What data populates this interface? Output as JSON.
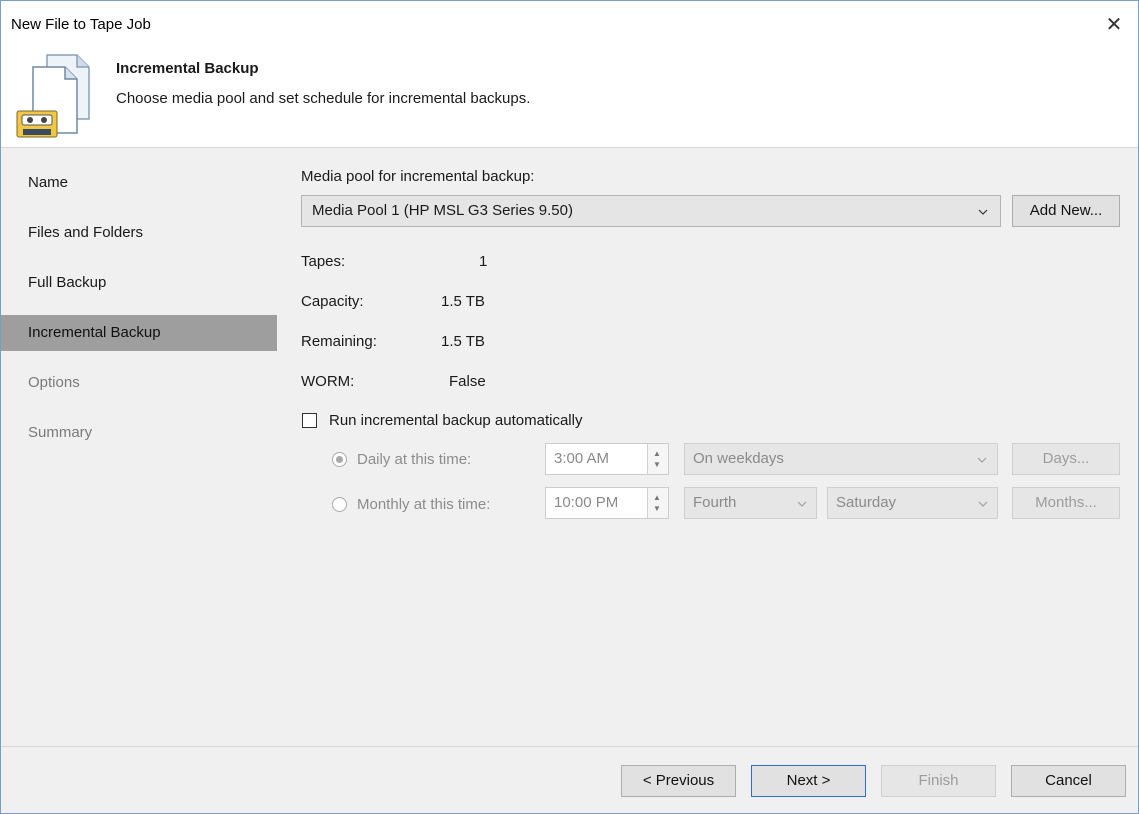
{
  "window": {
    "title": "New File to Tape Job"
  },
  "header": {
    "title": "Incremental Backup",
    "subtitle": "Choose media pool and set schedule for incremental backups."
  },
  "sidebar": {
    "items": [
      {
        "label": "Name",
        "state": "normal"
      },
      {
        "label": "Files and Folders",
        "state": "normal"
      },
      {
        "label": "Full Backup",
        "state": "normal"
      },
      {
        "label": "Incremental Backup",
        "state": "active"
      },
      {
        "label": "Options",
        "state": "disabled"
      },
      {
        "label": "Summary",
        "state": "disabled"
      }
    ]
  },
  "content": {
    "pool_label": "Media pool for incremental backup:",
    "pool_value": "Media Pool 1 (HP MSL G3 Series 9.50)",
    "add_new_label": "Add New...",
    "stats": {
      "tapes_label": "Tapes:",
      "tapes_value": "1",
      "capacity_label": "Capacity:",
      "capacity_value": "1.5 TB",
      "remaining_label": "Remaining:",
      "remaining_value": "1.5 TB",
      "worm_label": "WORM:",
      "worm_value": "False"
    },
    "run_auto_label": "Run incremental backup automatically",
    "run_auto_checked": false,
    "daily": {
      "label": "Daily at this time:",
      "time": "3:00 AM",
      "period": "On weekdays",
      "button": "Days...",
      "selected": true
    },
    "monthly": {
      "label": "Monthly at this time:",
      "time": "10:00 PM",
      "week": "Fourth",
      "day": "Saturday",
      "button": "Months...",
      "selected": false
    }
  },
  "footer": {
    "previous": "< Previous",
    "next": "Next >",
    "finish": "Finish",
    "cancel": "Cancel"
  },
  "colors": {
    "sidebar_active": "#9e9e9e",
    "panel_bg": "#f0f0f0",
    "primary_border": "#2a6fd1"
  }
}
